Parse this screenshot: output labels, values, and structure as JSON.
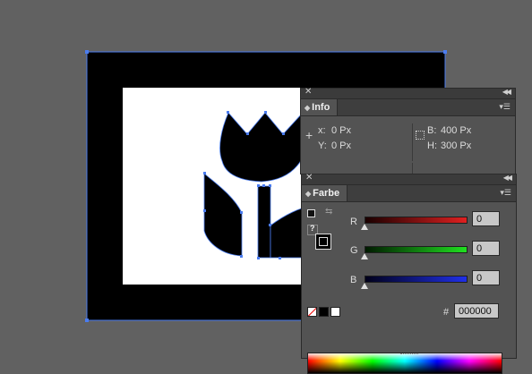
{
  "info_panel": {
    "title": "Info",
    "x_label": "x:",
    "x_value": "0 Px",
    "y_label": "Y:",
    "y_value": "0 Px",
    "b_label": "B:",
    "b_value": "400 Px",
    "h_label": "H:",
    "h_value": "300 Px"
  },
  "farbe_panel": {
    "title": "Farbe",
    "r_label": "R",
    "r_value": "0",
    "g_label": "G",
    "g_value": "0",
    "b_label": "B",
    "b_value": "0",
    "hex_label": "#",
    "hex_value": "000000",
    "question_mark": "?"
  },
  "colors": {
    "app_background": "#616161",
    "selection": "#4a7cf0",
    "fill": "#000000",
    "red_slider": "#d01818",
    "green_slider": "#18c018",
    "blue_slider": "#2030e0"
  },
  "icons": {
    "close": "close-icon",
    "collapse": "collapse-icon",
    "panel_menu": "panel-menu-icon",
    "crosshair": "crosshair-icon",
    "bounding_box": "bounding-box-icon",
    "fill_stroke": "fill-stroke-icon",
    "swap": "swap-icon"
  }
}
